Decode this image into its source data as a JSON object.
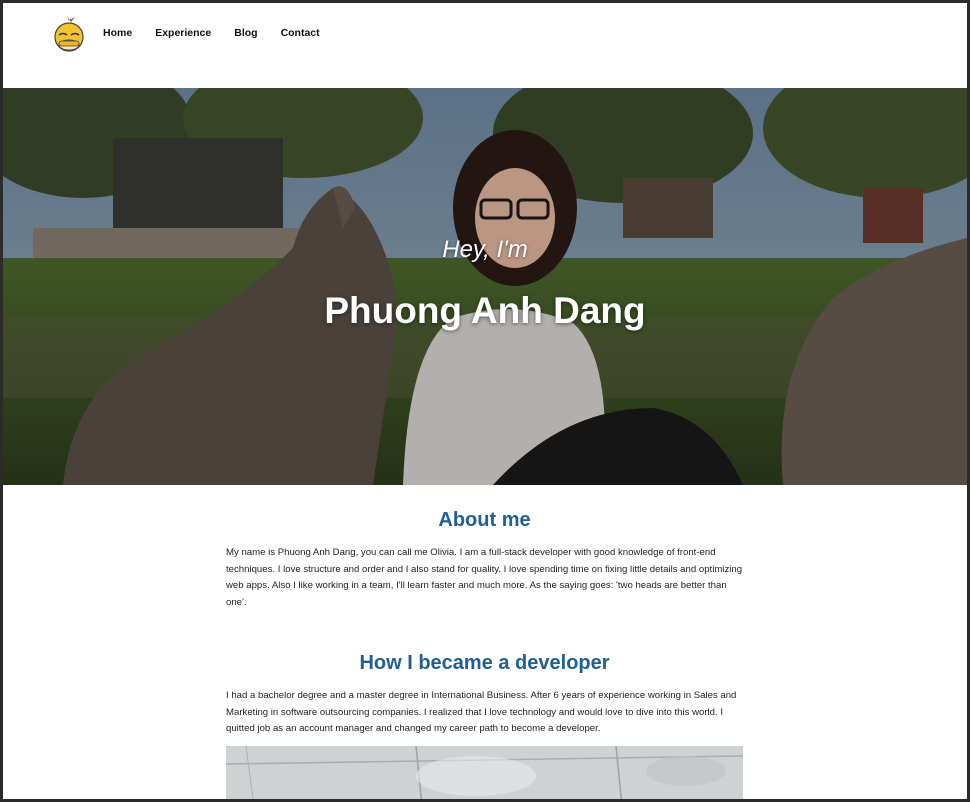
{
  "header": {
    "nav": [
      {
        "label": "Home"
      },
      {
        "label": "Experience"
      },
      {
        "label": "Blog"
      },
      {
        "label": "Contact"
      }
    ]
  },
  "hero": {
    "greeting": "Hey, I'm",
    "name": "Phuong Anh Dang"
  },
  "about": {
    "title": "About me",
    "text": "My name is Phuong Anh Dang, you can call me Olivia. I am a full-stack developer with good knowledge of front-end techniques. I love structure and order and I also stand for quality. I love spending time on fixing little details and optimizing web apps. Also I like working in a team, I'll learn faster and much more. As the saying goes: 'two heads are better than one'."
  },
  "developer": {
    "title": "How I became a developer",
    "text": "I had a bachelor degree and a master degree in International Business. After 6 years of experience working in Sales and Marketing in software outsourcing companies. I realized that I love technology and would love to dive into this world. I quitted job as an account manager and changed my career path to become a developer."
  },
  "colors": {
    "heading": "#1f5f95",
    "logo": "#f2c230"
  }
}
